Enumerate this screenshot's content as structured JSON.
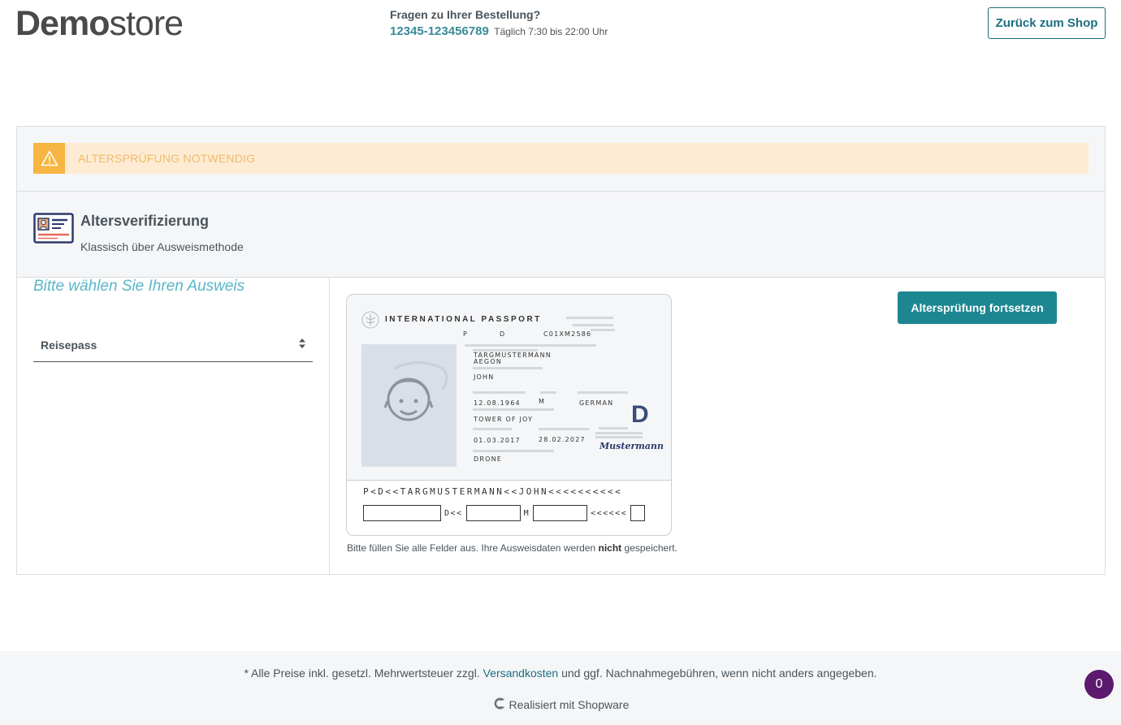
{
  "header": {
    "logo_bold": "Demo",
    "logo_light": "store",
    "hotline_question": "Fragen zu Ihrer Bestellung?",
    "hotline_number": "12345-123456789",
    "hotline_hours": "Täglich 7:30 bis 22:00 Uhr",
    "back_button": "Zurück zum Shop"
  },
  "alert": {
    "text": "ALTERSPRÜFUNG NOTWENDIG",
    "icon": "warning-icon",
    "color": "#f7b541"
  },
  "verification": {
    "title": "Altersverifizierung",
    "subtitle": "Klassisch über Ausweismethode",
    "icon": "id-card-icon"
  },
  "document_select": {
    "label": "Bitte wählen Sie Ihren Ausweis",
    "selected": "Reisepass",
    "icon": "sort-arrows-icon"
  },
  "passport": {
    "title": "INTERNATIONAL PASSPORT",
    "type": "P",
    "country_code": "D",
    "number": "C01XM2586",
    "surname_line1": "TARGMUSTERMANN",
    "surname_line2": "AEGON",
    "given_name": "JOHN",
    "birth_date": "12.08.1964",
    "sex": "M",
    "nationality": "GERMAN",
    "birth_place": "TOWER OF JOY",
    "issue_date": "01.03.2017",
    "expiry_date": "28.02.2027",
    "authority": "DRONE",
    "big_letter": "D",
    "signature": "Mustermann",
    "mrz_line": "P<D<<TARGMUSTERMANN<<JOHN<<<<<<<<<<",
    "mrz_sep1": "D<<",
    "mrz_sep2": "M",
    "mrz_sep3": "<<<<<<"
  },
  "continue_button": "Altersprüfung fortsetzen",
  "note_before": "Bitte füllen Sie alle Felder aus. Ihre Ausweisdaten werden ",
  "note_bold": "nicht",
  "note_after": " gespeichert.",
  "footer": {
    "vat_before": "* Alle Preise inkl. gesetzl. Mehrwertsteuer zzgl. ",
    "vat_link": "Versandkosten",
    "vat_after": " und ggf. Nachnahmegebühren, wenn nicht anders angegeben.",
    "powered": "Realisiert mit Shopware"
  },
  "cart_count": "0",
  "colors": {
    "accent": "#1c8790",
    "alert_bg": "#fdecd3",
    "badge": "#5b1a6e"
  }
}
